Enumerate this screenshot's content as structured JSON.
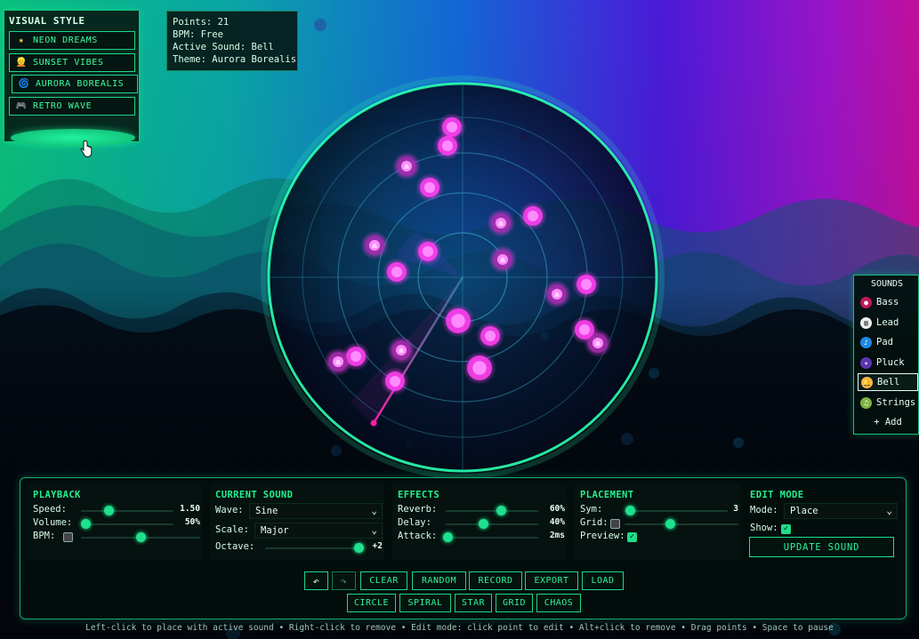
{
  "visual_style": {
    "title": "VISUAL STYLE",
    "items": [
      {
        "label": "NEON DREAMS",
        "icon": "star-icon",
        "glyph": "★"
      },
      {
        "label": "SUNSET VIBES",
        "icon": "person-icon",
        "glyph": "👱"
      },
      {
        "label": "AURORA BOREALIS",
        "icon": "galaxy-icon",
        "glyph": "🌀"
      },
      {
        "label": "RETRO WAVE",
        "icon": "gamepad-icon",
        "glyph": "🎮"
      }
    ]
  },
  "stats": {
    "points": "Points: 21",
    "bpm": "BPM: Free",
    "active_sound": "Active Sound: Bell",
    "theme": "Theme: Aurora Borealis"
  },
  "sounds": {
    "title": "SOUNDS",
    "items": [
      {
        "label": "Bass",
        "icon": "bass-icon",
        "color": "#c2185b",
        "glyph": "●"
      },
      {
        "label": "Lead",
        "icon": "piano-icon",
        "color": "#eeeeee",
        "glyph": "▥"
      },
      {
        "label": "Pad",
        "icon": "pad-icon",
        "color": "#1e88e5",
        "glyph": "♪"
      },
      {
        "label": "Pluck",
        "icon": "pluck-icon",
        "color": "#5e35b1",
        "glyph": "✦"
      },
      {
        "label": "Bell",
        "icon": "bell-icon",
        "color": "#ffb74d",
        "glyph": "🔔"
      },
      {
        "label": "Strings",
        "icon": "strings-icon",
        "color": "#7cb342",
        "glyph": "♫"
      }
    ],
    "active": "Bell",
    "add_label": "+ Add"
  },
  "playback": {
    "title": "PLAYBACK",
    "speed_label": "Speed:",
    "speed_value": "1.50",
    "speed_fraction": 0.3,
    "volume_label": "Volume:",
    "volume_value": "50%",
    "volume_fraction": 0.05,
    "bpm_label": "BPM:",
    "bpm_checked": false,
    "bpm_fraction": 0.5
  },
  "current_sound": {
    "title": "CURRENT SOUND",
    "wave_label": "Wave:",
    "wave_value": "Sine",
    "scale_label": "Scale:",
    "scale_value": "Major",
    "octave_label": "Octave:",
    "octave_value": "+2",
    "octave_fraction": 0.95
  },
  "effects": {
    "title": "EFFECTS",
    "reverb_label": "Reverb:",
    "reverb_value": "60%",
    "reverb_fraction": 0.6,
    "delay_label": "Delay:",
    "delay_value": "40%",
    "delay_fraction": 0.4,
    "attack_label": "Attack:",
    "attack_value": "2ms",
    "attack_fraction": 0.02
  },
  "placement": {
    "title": "PLACEMENT",
    "sym_label": "Sym:",
    "sym_value": "3",
    "sym_fraction": 0.05,
    "grid_label": "Grid:",
    "grid_checked": false,
    "grid_fraction": 0.4,
    "preview_label": "Preview:",
    "preview_checked": true
  },
  "edit_mode": {
    "title": "EDIT MODE",
    "mode_label": "Mode:",
    "mode_value": "Place",
    "show_label": "Show:",
    "show_checked": true,
    "update_label": "UPDATE SOUND"
  },
  "actions": {
    "undo_glyph": "↶",
    "redo_glyph": "↷",
    "row1": [
      "CLEAR",
      "RANDOM",
      "RECORD",
      "EXPORT",
      "LOAD"
    ],
    "row2": [
      "CIRCLE",
      "SPIRAL",
      "STAR",
      "GRID",
      "CHAOS"
    ]
  },
  "hint": "Left-click to place with active sound • Right-click to remove • Edit mode: click point to edit • Alt+click to remove • Drag points • Space to pause",
  "theme_colors": {
    "accent": "#1ee08e",
    "point": "#ff4cf0",
    "ring": "#2affb0"
  }
}
